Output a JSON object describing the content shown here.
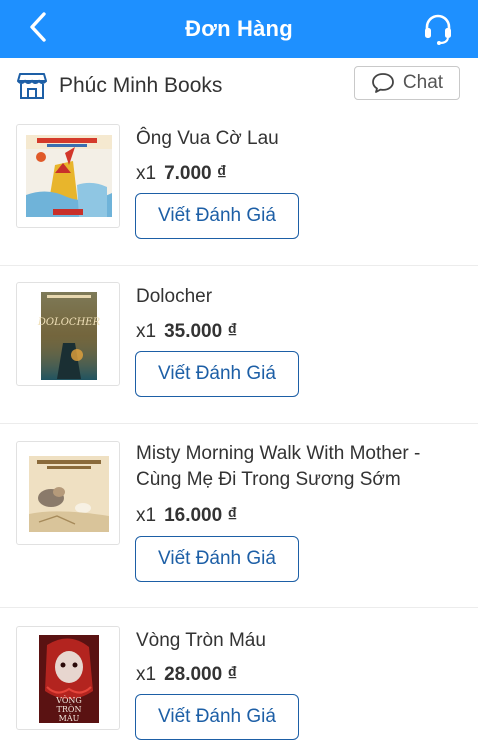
{
  "header": {
    "title": "Đơn Hàng",
    "back_icon": "chevron-left-icon",
    "support_icon": "headset-icon"
  },
  "shop": {
    "name": "Phúc Minh Books",
    "icon": "store-icon",
    "chat_label": "Chat",
    "chat_icon": "chat-bubble-icon"
  },
  "colors": {
    "header": "#1e90ff",
    "button_border": "#1d5fa6",
    "button_text": "#1d5fa6"
  },
  "items": [
    {
      "name_lines": [
        "Ông Vua Cờ Lau"
      ],
      "qty": "x1",
      "price": "7.000 ₫",
      "review_label": "Viết Đánh Giá"
    },
    {
      "name_lines": [
        "Dolocher"
      ],
      "qty": "x1",
      "price": "35.000 ₫",
      "review_label": "Viết Đánh Giá"
    },
    {
      "name_lines": [
        "Misty Morning Walk With Mother -",
        "Cùng Mẹ Đi Trong Sương Sớm"
      ],
      "qty": "x1",
      "price": "16.000 ₫",
      "review_label": "Viết Đánh Giá"
    },
    {
      "name_lines": [
        "Vòng Tròn Máu"
      ],
      "qty": "x1",
      "price": "28.000 ₫",
      "review_label": "Viết Đánh Giá"
    }
  ]
}
